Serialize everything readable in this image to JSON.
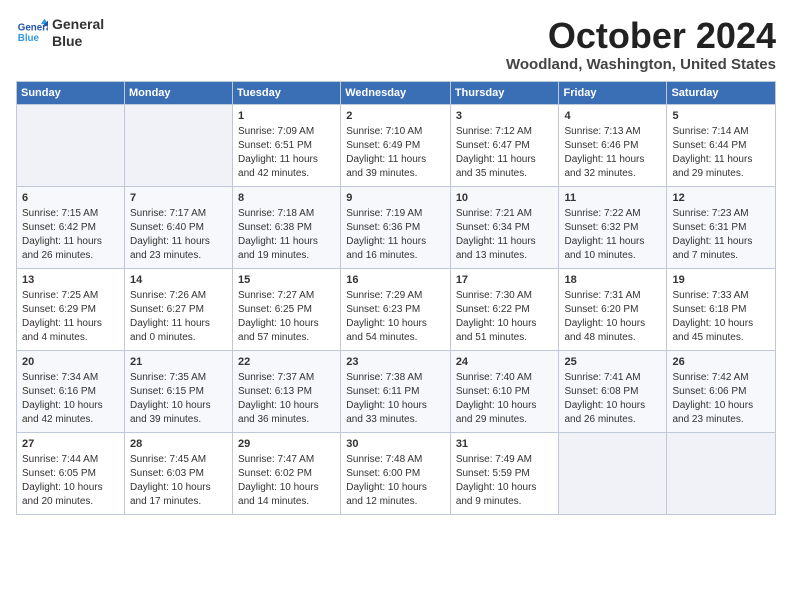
{
  "header": {
    "logo_line1": "General",
    "logo_line2": "Blue",
    "month": "October 2024",
    "location": "Woodland, Washington, United States"
  },
  "days_of_week": [
    "Sunday",
    "Monday",
    "Tuesday",
    "Wednesday",
    "Thursday",
    "Friday",
    "Saturday"
  ],
  "weeks": [
    [
      {
        "day": "",
        "info": ""
      },
      {
        "day": "",
        "info": ""
      },
      {
        "day": "1",
        "info": "Sunrise: 7:09 AM\nSunset: 6:51 PM\nDaylight: 11 hours and 42 minutes."
      },
      {
        "day": "2",
        "info": "Sunrise: 7:10 AM\nSunset: 6:49 PM\nDaylight: 11 hours and 39 minutes."
      },
      {
        "day": "3",
        "info": "Sunrise: 7:12 AM\nSunset: 6:47 PM\nDaylight: 11 hours and 35 minutes."
      },
      {
        "day": "4",
        "info": "Sunrise: 7:13 AM\nSunset: 6:46 PM\nDaylight: 11 hours and 32 minutes."
      },
      {
        "day": "5",
        "info": "Sunrise: 7:14 AM\nSunset: 6:44 PM\nDaylight: 11 hours and 29 minutes."
      }
    ],
    [
      {
        "day": "6",
        "info": "Sunrise: 7:15 AM\nSunset: 6:42 PM\nDaylight: 11 hours and 26 minutes."
      },
      {
        "day": "7",
        "info": "Sunrise: 7:17 AM\nSunset: 6:40 PM\nDaylight: 11 hours and 23 minutes."
      },
      {
        "day": "8",
        "info": "Sunrise: 7:18 AM\nSunset: 6:38 PM\nDaylight: 11 hours and 19 minutes."
      },
      {
        "day": "9",
        "info": "Sunrise: 7:19 AM\nSunset: 6:36 PM\nDaylight: 11 hours and 16 minutes."
      },
      {
        "day": "10",
        "info": "Sunrise: 7:21 AM\nSunset: 6:34 PM\nDaylight: 11 hours and 13 minutes."
      },
      {
        "day": "11",
        "info": "Sunrise: 7:22 AM\nSunset: 6:32 PM\nDaylight: 11 hours and 10 minutes."
      },
      {
        "day": "12",
        "info": "Sunrise: 7:23 AM\nSunset: 6:31 PM\nDaylight: 11 hours and 7 minutes."
      }
    ],
    [
      {
        "day": "13",
        "info": "Sunrise: 7:25 AM\nSunset: 6:29 PM\nDaylight: 11 hours and 4 minutes."
      },
      {
        "day": "14",
        "info": "Sunrise: 7:26 AM\nSunset: 6:27 PM\nDaylight: 11 hours and 0 minutes."
      },
      {
        "day": "15",
        "info": "Sunrise: 7:27 AM\nSunset: 6:25 PM\nDaylight: 10 hours and 57 minutes."
      },
      {
        "day": "16",
        "info": "Sunrise: 7:29 AM\nSunset: 6:23 PM\nDaylight: 10 hours and 54 minutes."
      },
      {
        "day": "17",
        "info": "Sunrise: 7:30 AM\nSunset: 6:22 PM\nDaylight: 10 hours and 51 minutes."
      },
      {
        "day": "18",
        "info": "Sunrise: 7:31 AM\nSunset: 6:20 PM\nDaylight: 10 hours and 48 minutes."
      },
      {
        "day": "19",
        "info": "Sunrise: 7:33 AM\nSunset: 6:18 PM\nDaylight: 10 hours and 45 minutes."
      }
    ],
    [
      {
        "day": "20",
        "info": "Sunrise: 7:34 AM\nSunset: 6:16 PM\nDaylight: 10 hours and 42 minutes."
      },
      {
        "day": "21",
        "info": "Sunrise: 7:35 AM\nSunset: 6:15 PM\nDaylight: 10 hours and 39 minutes."
      },
      {
        "day": "22",
        "info": "Sunrise: 7:37 AM\nSunset: 6:13 PM\nDaylight: 10 hours and 36 minutes."
      },
      {
        "day": "23",
        "info": "Sunrise: 7:38 AM\nSunset: 6:11 PM\nDaylight: 10 hours and 33 minutes."
      },
      {
        "day": "24",
        "info": "Sunrise: 7:40 AM\nSunset: 6:10 PM\nDaylight: 10 hours and 29 minutes."
      },
      {
        "day": "25",
        "info": "Sunrise: 7:41 AM\nSunset: 6:08 PM\nDaylight: 10 hours and 26 minutes."
      },
      {
        "day": "26",
        "info": "Sunrise: 7:42 AM\nSunset: 6:06 PM\nDaylight: 10 hours and 23 minutes."
      }
    ],
    [
      {
        "day": "27",
        "info": "Sunrise: 7:44 AM\nSunset: 6:05 PM\nDaylight: 10 hours and 20 minutes."
      },
      {
        "day": "28",
        "info": "Sunrise: 7:45 AM\nSunset: 6:03 PM\nDaylight: 10 hours and 17 minutes."
      },
      {
        "day": "29",
        "info": "Sunrise: 7:47 AM\nSunset: 6:02 PM\nDaylight: 10 hours and 14 minutes."
      },
      {
        "day": "30",
        "info": "Sunrise: 7:48 AM\nSunset: 6:00 PM\nDaylight: 10 hours and 12 minutes."
      },
      {
        "day": "31",
        "info": "Sunrise: 7:49 AM\nSunset: 5:59 PM\nDaylight: 10 hours and 9 minutes."
      },
      {
        "day": "",
        "info": ""
      },
      {
        "day": "",
        "info": ""
      }
    ]
  ]
}
